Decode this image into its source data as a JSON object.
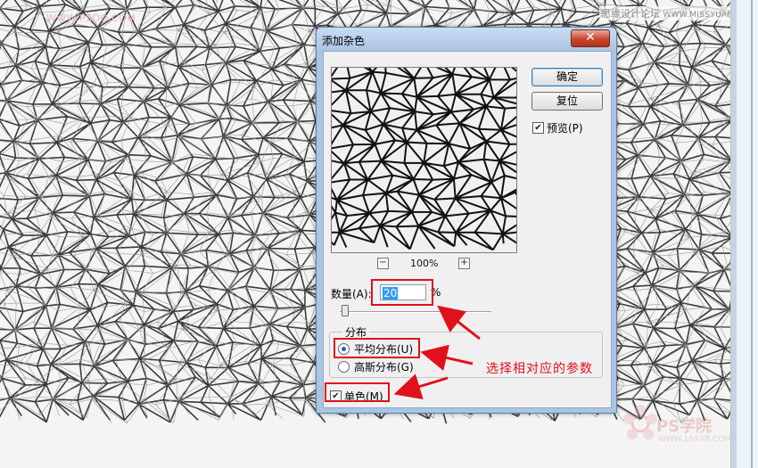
{
  "background": {
    "watermark_left": "WWW.PSDO.COM",
    "watermark_right_text": "思缘设计论坛",
    "watermark_right_site": "WWW.MISSYUAN.COM",
    "logo_text": "PS学院",
    "logo_sub": "WWW.16XX8.COM"
  },
  "dialog": {
    "title": "添加杂色",
    "close_glyph": "✕",
    "ok_label": "确定",
    "reset_label": "复位",
    "preview_label": "预览(P)",
    "preview_checked": true,
    "zoom": {
      "minus": "−",
      "plus": "+",
      "value": "100%"
    },
    "amount": {
      "label": "数量(A):",
      "value": "20",
      "unit": "%",
      "slider_fraction": 0.02
    },
    "distribution": {
      "title": "分布",
      "uniform_label": "平均分布(U)",
      "gaussian_label": "高斯分布(G)",
      "selected": "uniform"
    },
    "monochromatic": {
      "label": "单色(M)",
      "checked": true
    }
  },
  "annotation": {
    "text": "选择相对应的参数",
    "color": "#e0111b"
  }
}
